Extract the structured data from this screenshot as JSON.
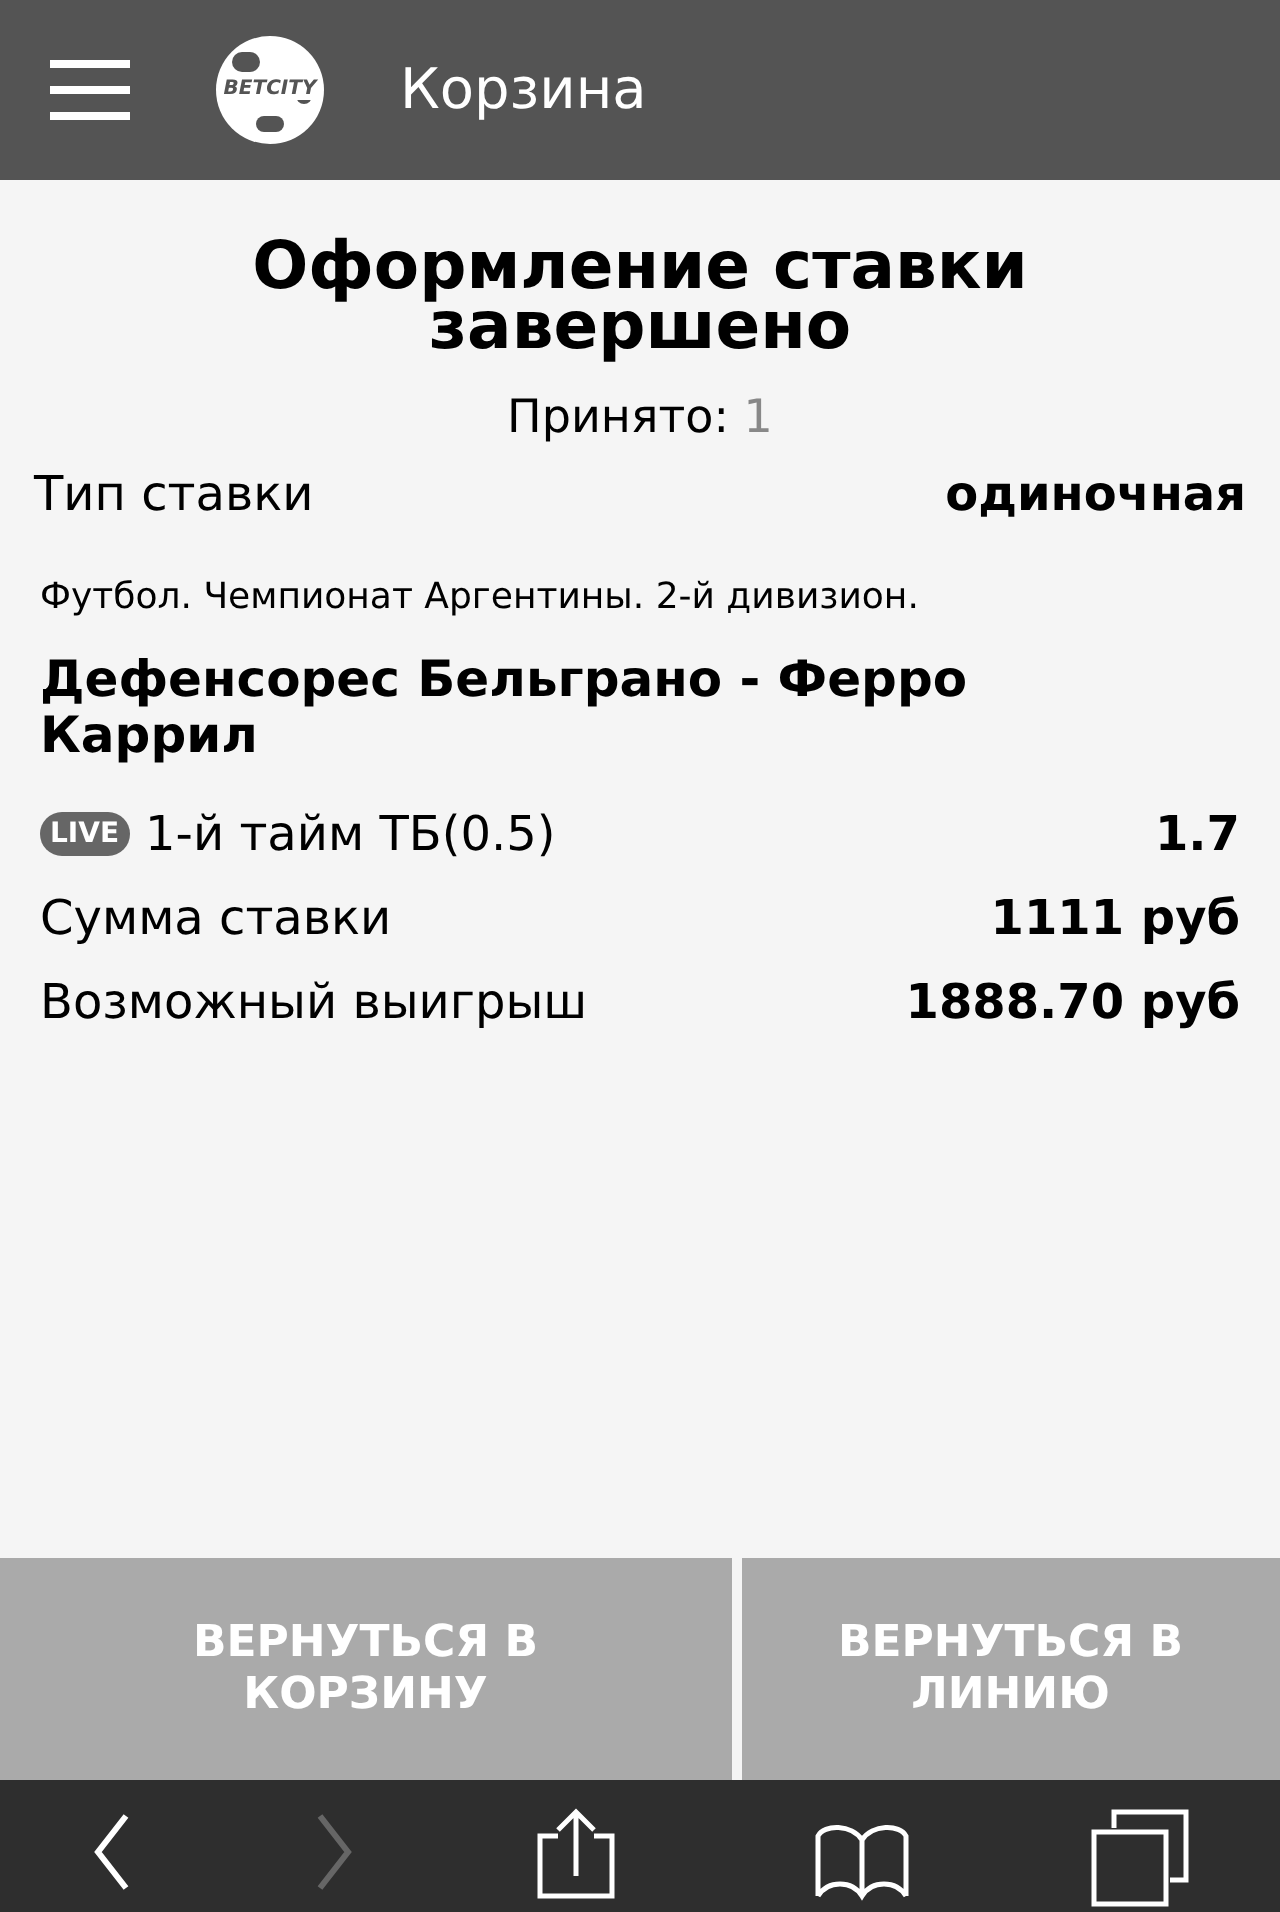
{
  "header": {
    "logo_text": "BETCITY",
    "title": "Корзина"
  },
  "result": {
    "title": "Оформление ставки завершено",
    "accepted_label": "Принято:",
    "accepted_count": "1"
  },
  "bet_type": {
    "label": "Тип ставки",
    "value": "одиночная"
  },
  "event": {
    "tournament": "Футбол. Чемпионат Аргентины. 2-й дивизион.",
    "match": "Дефенсорес Бельграно - Ферро Каррил"
  },
  "details": [
    {
      "kind": "outcome",
      "badge": "LIVE",
      "label": "1-й тайм ТБ(0.5)",
      "value": "1.7"
    },
    {
      "kind": "plain",
      "label": "Сумма ставки",
      "value": "1111 руб"
    },
    {
      "kind": "plain",
      "label": "Возможный выигрыш",
      "value": "1888.70 руб"
    }
  ],
  "buttons": [
    "ВЕРНУТЬСЯ В КОРЗИНУ",
    "ВЕРНУТЬСЯ В ЛИНИЮ"
  ],
  "toolbar": [
    {
      "kind": "back",
      "disabled": false
    },
    {
      "kind": "forward",
      "disabled": true
    },
    {
      "kind": "share",
      "disabled": false
    },
    {
      "kind": "bookmarks",
      "disabled": false
    },
    {
      "kind": "tabs",
      "disabled": false
    }
  ]
}
